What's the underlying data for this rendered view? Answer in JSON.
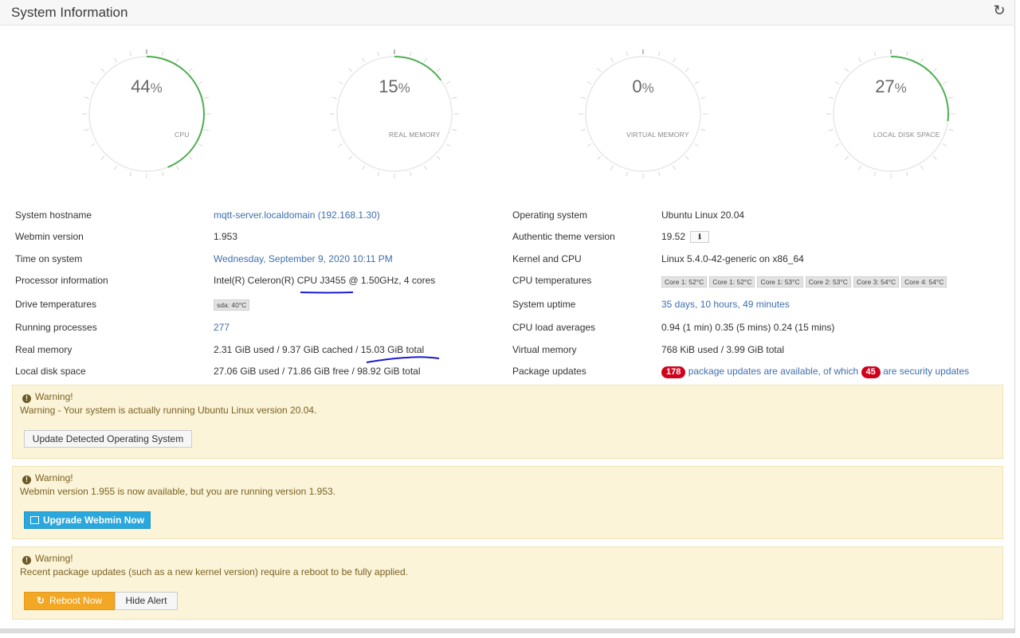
{
  "header": {
    "title": "System Information",
    "reload_icon": "refresh-icon"
  },
  "gauges": [
    {
      "value": 44,
      "pct_sign": "%",
      "label": "CPU",
      "fraction": 0.44
    },
    {
      "value": 15,
      "pct_sign": "%",
      "label": "REAL MEMORY",
      "fraction": 0.15
    },
    {
      "value": 0,
      "pct_sign": "%",
      "label": "VIRTUAL MEMORY",
      "fraction": 0.0
    },
    {
      "value": 27,
      "pct_sign": "%",
      "label": "LOCAL DISK SPACE",
      "fraction": 0.27
    }
  ],
  "colors": {
    "gauge_fill": "#4caf50",
    "gauge_track": "#e8e8e8",
    "link": "#3f6fae",
    "badge": "#d0021b",
    "annotation": "#1a1acf"
  },
  "info_left": [
    {
      "label": "System hostname",
      "value": "mqtt-server.localdomain (192.168.1.30)"
    },
    {
      "label": "Webmin version",
      "value": "1.953"
    },
    {
      "label": "Time on system",
      "value": "Wednesday, September 9, 2020 10:11 PM"
    },
    {
      "label": "Processor information",
      "value": "Intel(R) Celeron(R) CPU J3455 @ 1.50GHz, 4 cores"
    },
    {
      "label": "Drive temperatures",
      "value": "sda: 40°C"
    },
    {
      "label": "Running processes",
      "value": "277"
    },
    {
      "label": "Real memory",
      "value": "2.31 GiB used / 9.37 GiB cached / 15.03 GiB total"
    },
    {
      "label": "Local disk space",
      "value": "27.06 GiB used / 71.86 GiB free / 98.92 GiB total"
    }
  ],
  "info_right": [
    {
      "label": "Operating system",
      "value": "Ubuntu Linux 20.04"
    },
    {
      "label": "Authentic theme version",
      "value": "19.52"
    },
    {
      "label": "Kernel and CPU",
      "value": "Linux 5.4.0-42-generic on x86_64"
    },
    {
      "label": "CPU temperatures",
      "tags": [
        "Core 1: 52°C",
        "Core 1: 52°C",
        "Core 1: 53°C",
        "Core 2: 53°C",
        "Core 3: 54°C",
        "Core 4: 54°C"
      ]
    },
    {
      "label": "System uptime",
      "value": "35 days, 10 hours, 49 minutes"
    },
    {
      "label": "CPU load averages",
      "value": "0.94 (1 min) 0.35 (5 mins) 0.24 (15 mins)"
    },
    {
      "label": "Virtual memory",
      "value": "768 KiB used / 3.99 GiB total"
    },
    {
      "label": "Package updates",
      "count": "178",
      "text1": "package updates are available, of which",
      "security": "45",
      "text2": "are security updates"
    }
  ],
  "alerts": [
    {
      "title": "Warning!",
      "message": "Warning - Your system is actually running Ubuntu Linux version 20.04.",
      "button": "Update Detected Operating System"
    },
    {
      "title": "Warning!",
      "message": "Webmin version 1.955 is now available, but you are running version 1.953.",
      "button": "Upgrade Webmin Now"
    },
    {
      "title": "Warning!",
      "message": "Recent package updates (such as a new kernel version) require a reboot to be fully applied.",
      "button": "Reboot Now",
      "button2": "Hide Alert"
    }
  ]
}
